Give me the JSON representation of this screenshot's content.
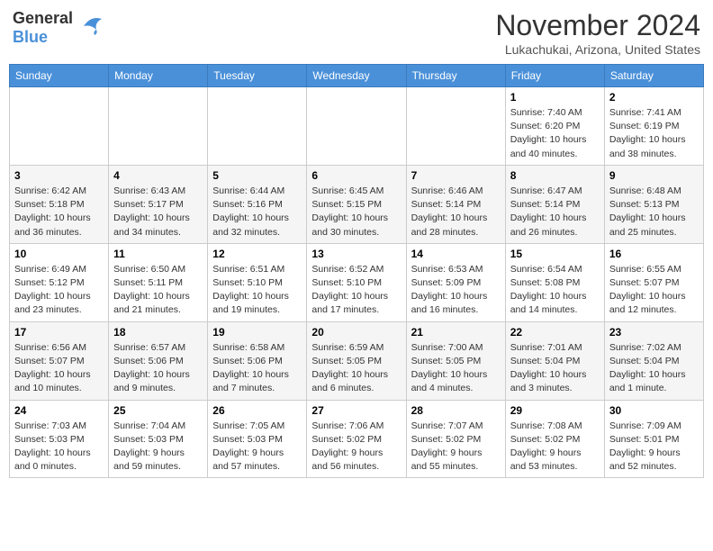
{
  "header": {
    "logo_general": "General",
    "logo_blue": "Blue",
    "month": "November 2024",
    "location": "Lukachukai, Arizona, United States"
  },
  "weekdays": [
    "Sunday",
    "Monday",
    "Tuesday",
    "Wednesday",
    "Thursday",
    "Friday",
    "Saturday"
  ],
  "weeks": [
    [
      {
        "day": "",
        "info": ""
      },
      {
        "day": "",
        "info": ""
      },
      {
        "day": "",
        "info": ""
      },
      {
        "day": "",
        "info": ""
      },
      {
        "day": "",
        "info": ""
      },
      {
        "day": "1",
        "info": "Sunrise: 7:40 AM\nSunset: 6:20 PM\nDaylight: 10 hours\nand 40 minutes."
      },
      {
        "day": "2",
        "info": "Sunrise: 7:41 AM\nSunset: 6:19 PM\nDaylight: 10 hours\nand 38 minutes."
      }
    ],
    [
      {
        "day": "3",
        "info": "Sunrise: 6:42 AM\nSunset: 5:18 PM\nDaylight: 10 hours\nand 36 minutes."
      },
      {
        "day": "4",
        "info": "Sunrise: 6:43 AM\nSunset: 5:17 PM\nDaylight: 10 hours\nand 34 minutes."
      },
      {
        "day": "5",
        "info": "Sunrise: 6:44 AM\nSunset: 5:16 PM\nDaylight: 10 hours\nand 32 minutes."
      },
      {
        "day": "6",
        "info": "Sunrise: 6:45 AM\nSunset: 5:15 PM\nDaylight: 10 hours\nand 30 minutes."
      },
      {
        "day": "7",
        "info": "Sunrise: 6:46 AM\nSunset: 5:14 PM\nDaylight: 10 hours\nand 28 minutes."
      },
      {
        "day": "8",
        "info": "Sunrise: 6:47 AM\nSunset: 5:14 PM\nDaylight: 10 hours\nand 26 minutes."
      },
      {
        "day": "9",
        "info": "Sunrise: 6:48 AM\nSunset: 5:13 PM\nDaylight: 10 hours\nand 25 minutes."
      }
    ],
    [
      {
        "day": "10",
        "info": "Sunrise: 6:49 AM\nSunset: 5:12 PM\nDaylight: 10 hours\nand 23 minutes."
      },
      {
        "day": "11",
        "info": "Sunrise: 6:50 AM\nSunset: 5:11 PM\nDaylight: 10 hours\nand 21 minutes."
      },
      {
        "day": "12",
        "info": "Sunrise: 6:51 AM\nSunset: 5:10 PM\nDaylight: 10 hours\nand 19 minutes."
      },
      {
        "day": "13",
        "info": "Sunrise: 6:52 AM\nSunset: 5:10 PM\nDaylight: 10 hours\nand 17 minutes."
      },
      {
        "day": "14",
        "info": "Sunrise: 6:53 AM\nSunset: 5:09 PM\nDaylight: 10 hours\nand 16 minutes."
      },
      {
        "day": "15",
        "info": "Sunrise: 6:54 AM\nSunset: 5:08 PM\nDaylight: 10 hours\nand 14 minutes."
      },
      {
        "day": "16",
        "info": "Sunrise: 6:55 AM\nSunset: 5:07 PM\nDaylight: 10 hours\nand 12 minutes."
      }
    ],
    [
      {
        "day": "17",
        "info": "Sunrise: 6:56 AM\nSunset: 5:07 PM\nDaylight: 10 hours\nand 10 minutes."
      },
      {
        "day": "18",
        "info": "Sunrise: 6:57 AM\nSunset: 5:06 PM\nDaylight: 10 hours\nand 9 minutes."
      },
      {
        "day": "19",
        "info": "Sunrise: 6:58 AM\nSunset: 5:06 PM\nDaylight: 10 hours\nand 7 minutes."
      },
      {
        "day": "20",
        "info": "Sunrise: 6:59 AM\nSunset: 5:05 PM\nDaylight: 10 hours\nand 6 minutes."
      },
      {
        "day": "21",
        "info": "Sunrise: 7:00 AM\nSunset: 5:05 PM\nDaylight: 10 hours\nand 4 minutes."
      },
      {
        "day": "22",
        "info": "Sunrise: 7:01 AM\nSunset: 5:04 PM\nDaylight: 10 hours\nand 3 minutes."
      },
      {
        "day": "23",
        "info": "Sunrise: 7:02 AM\nSunset: 5:04 PM\nDaylight: 10 hours\nand 1 minute."
      }
    ],
    [
      {
        "day": "24",
        "info": "Sunrise: 7:03 AM\nSunset: 5:03 PM\nDaylight: 10 hours\nand 0 minutes."
      },
      {
        "day": "25",
        "info": "Sunrise: 7:04 AM\nSunset: 5:03 PM\nDaylight: 9 hours\nand 59 minutes."
      },
      {
        "day": "26",
        "info": "Sunrise: 7:05 AM\nSunset: 5:03 PM\nDaylight: 9 hours\nand 57 minutes."
      },
      {
        "day": "27",
        "info": "Sunrise: 7:06 AM\nSunset: 5:02 PM\nDaylight: 9 hours\nand 56 minutes."
      },
      {
        "day": "28",
        "info": "Sunrise: 7:07 AM\nSunset: 5:02 PM\nDaylight: 9 hours\nand 55 minutes."
      },
      {
        "day": "29",
        "info": "Sunrise: 7:08 AM\nSunset: 5:02 PM\nDaylight: 9 hours\nand 53 minutes."
      },
      {
        "day": "30",
        "info": "Sunrise: 7:09 AM\nSunset: 5:01 PM\nDaylight: 9 hours\nand 52 minutes."
      }
    ]
  ]
}
